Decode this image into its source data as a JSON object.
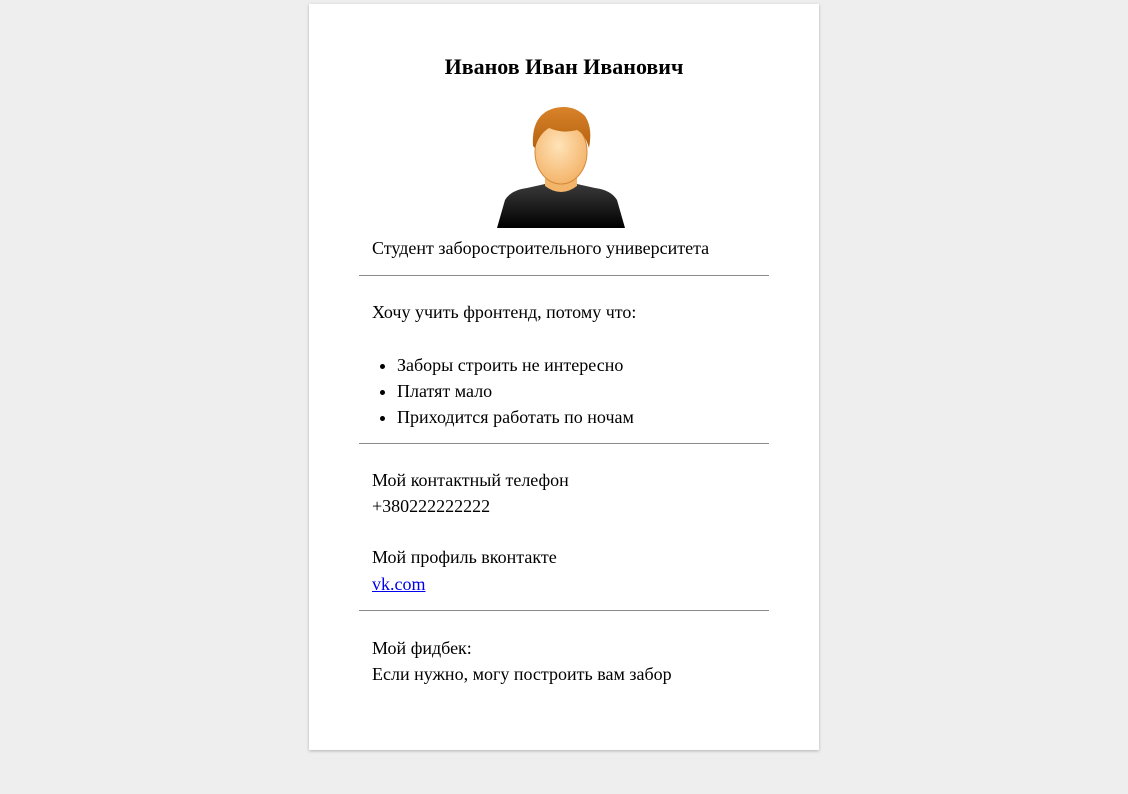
{
  "profile": {
    "name": "Иванов Иван Иванович",
    "status": "Студент заборостроительного университета"
  },
  "motivation": {
    "heading": "Хочу учить фронтенд, потому что:",
    "reasons": [
      "Заборы строить не интересно",
      "Платят мало",
      "Приходится работать по ночам"
    ]
  },
  "contacts": {
    "phone_label": "Мой контактный телефон",
    "phone": "+380222222222",
    "vk_label": "Мой профиль вконтакте",
    "vk_link": "vk.com"
  },
  "feedback": {
    "label": "Мой фидбек:",
    "text": "Если нужно, могу построить вам забор"
  },
  "colors": {
    "page_background": "#eeeeee",
    "card_background": "#ffffff",
    "link": "#0000ee",
    "divider": "#8a8a8a"
  },
  "icons": {
    "avatar": "user-avatar-icon"
  }
}
